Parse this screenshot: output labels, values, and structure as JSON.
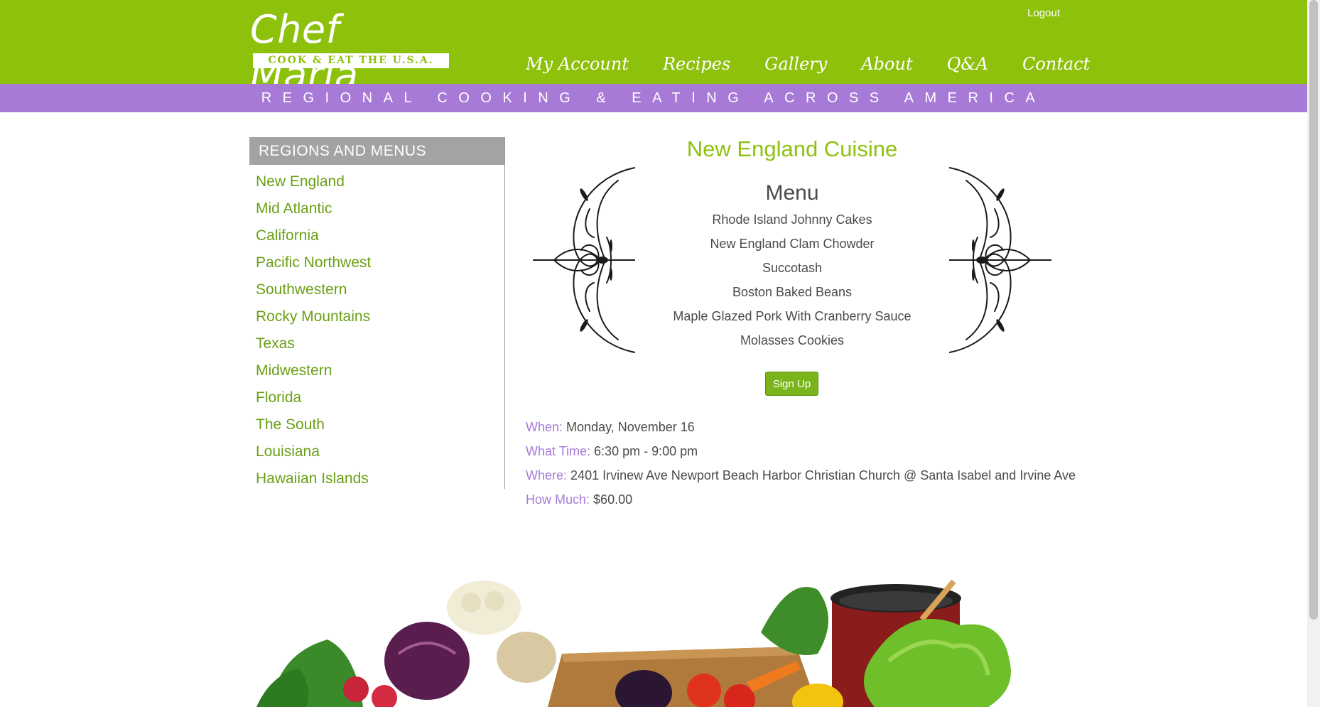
{
  "header": {
    "logo_title": "Chef Marla",
    "logo_tagline": "COOK & EAT THE U.S.A.",
    "logout_label": "Logout",
    "nav": [
      "My Account",
      "Recipes",
      "Gallery",
      "About",
      "Q&A",
      "Contact"
    ],
    "strip_text": "REGIONAL COOKING & EATING ACROSS AMERICA"
  },
  "sidebar": {
    "heading": "REGIONS AND MENUS",
    "items": [
      "New England",
      "Mid Atlantic",
      "California",
      "Pacific Northwest",
      "Southwestern",
      "Rocky Mountains",
      "Texas",
      "Midwestern",
      "Florida",
      "The South",
      "Louisiana",
      "Hawaiian Islands"
    ]
  },
  "main": {
    "title": "New England Cuisine",
    "menu_title": "Menu",
    "menu_items": [
      "Rhode Island Johnny Cakes",
      "New England Clam Chowder",
      "Succotash",
      "Boston Baked Beans",
      "Maple Glazed Pork With Cranberry Sauce",
      "Molasses Cookies"
    ],
    "signup_label": "Sign Up",
    "details": {
      "when_label": "When:",
      "when_value": "Monday, November 16",
      "time_label": "What Time:",
      "time_value": "6:30 pm - 9:00 pm",
      "where_label": "Where:",
      "where_value": "2401 Irvinew Ave Newport Beach Harbor Christian Church @ Santa Isabel and Irvine Ave",
      "cost_label": "How Much:",
      "cost_value": "$60.00"
    }
  },
  "colors": {
    "brand_green": "#8dc10c",
    "accent_purple": "#a77ad8",
    "link_green": "#6aa015"
  }
}
